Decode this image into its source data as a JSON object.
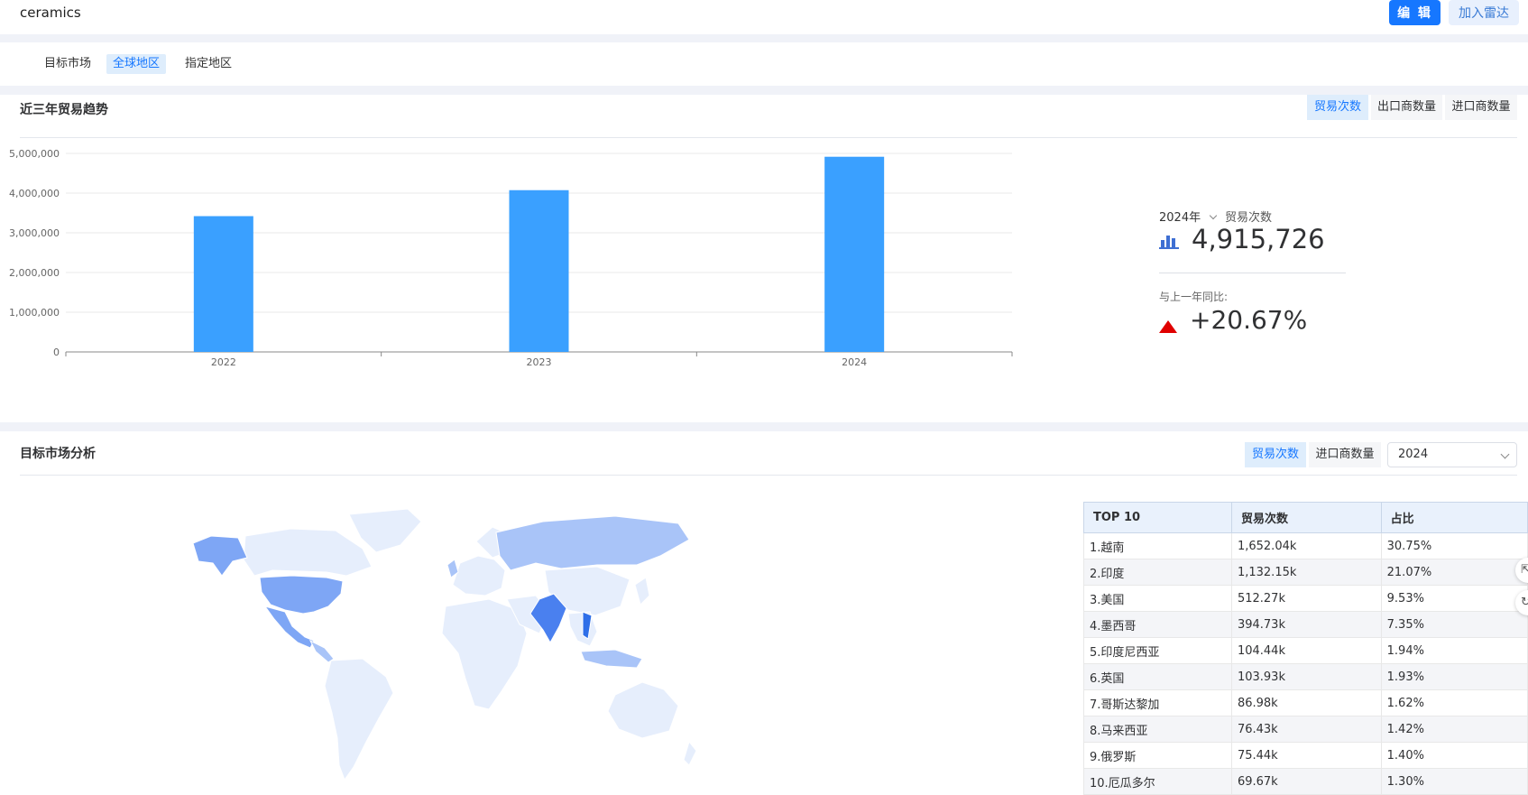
{
  "header": {
    "title": "ceramics",
    "edit_label": "编 辑",
    "radar_label": "加入雷达"
  },
  "tabs": [
    {
      "label": "目标市场",
      "active": false
    },
    {
      "label": "全球地区",
      "active": true
    },
    {
      "label": "指定地区",
      "active": false
    }
  ],
  "trend": {
    "title": "近三年贸易趋势",
    "toggles": [
      "贸易次数",
      "出口商数量",
      "进口商数量"
    ],
    "active_toggle": 0,
    "stat": {
      "year": "2024年",
      "metric": "贸易次数",
      "value": "4,915,726",
      "compare_label": "与上一年同比:",
      "change": "+20.67%",
      "icon": "bar-chart-icon",
      "trend_icon": "arrow-up-icon"
    }
  },
  "chart_data": {
    "type": "bar",
    "categories": [
      "2022",
      "2023",
      "2024"
    ],
    "values": [
      3420000,
      4074000,
      4915726
    ],
    "ylim": [
      0,
      5000000
    ],
    "yticks": [
      0,
      1000000,
      2000000,
      3000000,
      4000000,
      5000000
    ],
    "ytick_labels": [
      "0",
      "1,000,000",
      "2,000,000",
      "3,000,000",
      "4,000,000",
      "5,000,000"
    ],
    "grid": true,
    "bar_color": "#3aa0ff"
  },
  "market": {
    "title": "目标市场分析",
    "toggles": [
      "贸易次数",
      "进口商数量"
    ],
    "active_toggle": 0,
    "year_select": "2024",
    "table": {
      "headers": [
        "TOP 10",
        "贸易次数",
        "占比"
      ],
      "rows": [
        [
          "1.越南",
          "1,652.04k",
          "30.75%"
        ],
        [
          "2.印度",
          "1,132.15k",
          "21.07%"
        ],
        [
          "3.美国",
          "512.27k",
          "9.53%"
        ],
        [
          "4.墨西哥",
          "394.73k",
          "7.35%"
        ],
        [
          "5.印度尼西亚",
          "104.44k",
          "1.94%"
        ],
        [
          "6.英国",
          "103.93k",
          "1.93%"
        ],
        [
          "7.哥斯达黎加",
          "86.98k",
          "1.62%"
        ],
        [
          "8.马来西亚",
          "76.43k",
          "1.42%"
        ],
        [
          "9.俄罗斯",
          "75.44k",
          "1.40%"
        ],
        [
          "10.厄瓜多尔",
          "69.67k",
          "1.30%"
        ]
      ]
    },
    "map_colors": {
      "base": "#e6eefc",
      "low": "#a9c4f8",
      "mid": "#7ea6f5",
      "high": "#4a80ef",
      "top": "#2f6fe8"
    }
  }
}
